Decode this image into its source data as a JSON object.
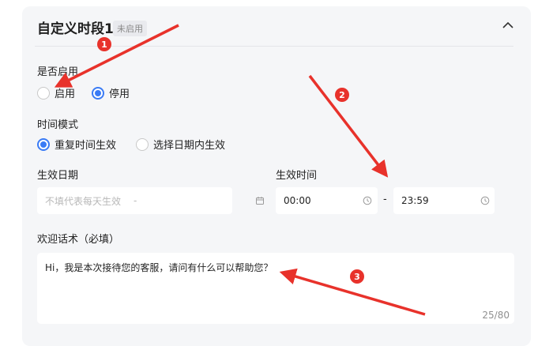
{
  "header": {
    "title": "自定义时段1",
    "badge": "未启用"
  },
  "enable": {
    "label": "是否启用",
    "options": [
      "启用",
      "停用"
    ],
    "selected": "停用"
  },
  "mode": {
    "label": "时间模式",
    "options": [
      "重复时间生效",
      "选择日期内生效"
    ],
    "selected": "重复时间生效"
  },
  "date": {
    "label": "生效日期",
    "placeholder": "不填代表每天生效",
    "separator": "-"
  },
  "time": {
    "label": "生效时间",
    "start": "00:00",
    "separator": "-",
    "end": "23:59"
  },
  "greeting": {
    "label": "欢迎话术（必填）",
    "text": "Hi，我是本次接待您的客服，请问有什么可以帮助您？",
    "counter": "25/80"
  },
  "annotations": {
    "markers": [
      "1",
      "2",
      "3"
    ],
    "color": "#e8322b"
  },
  "colors": {
    "accent": "#3a7bf5",
    "card_bg": "#f5f6f8"
  }
}
